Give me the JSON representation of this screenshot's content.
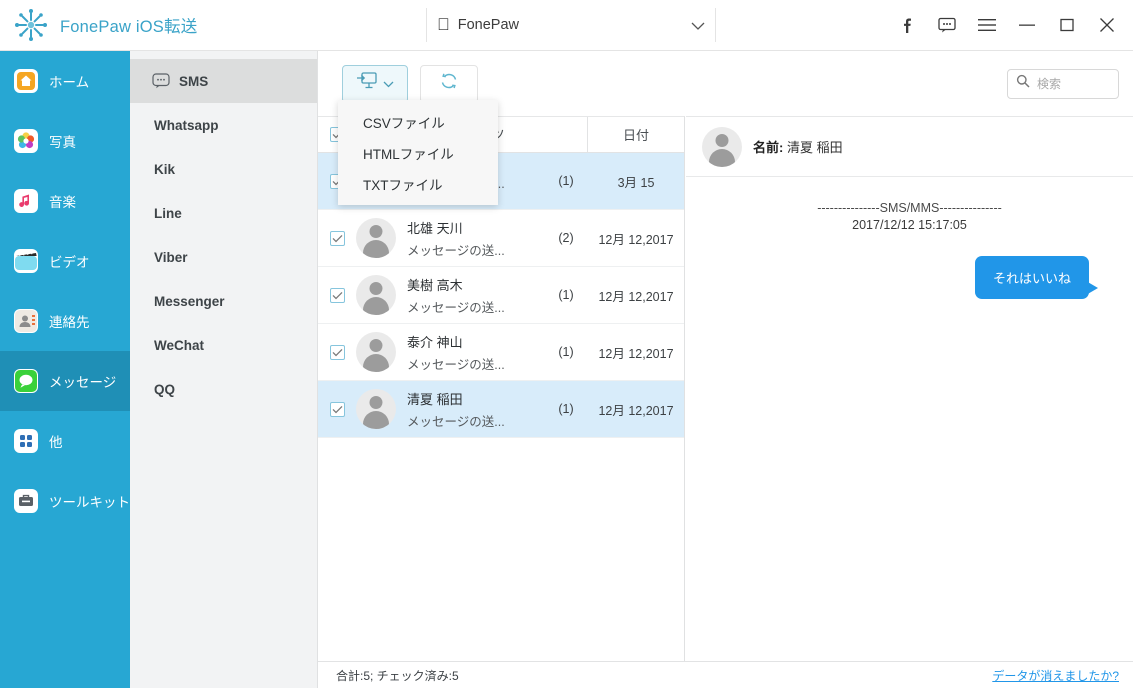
{
  "titlebar": {
    "logo_icon": "snowflake-logo",
    "app_title": "FonePaw iOS転送",
    "device": {
      "apple_icon": "apple-icon",
      "name": "FonePaw",
      "chevron_icon": "chevron-down-icon"
    },
    "controls": [
      {
        "name": "facebook-icon",
        "label": "f"
      },
      {
        "name": "feedback-icon",
        "label": ""
      },
      {
        "name": "menu-icon",
        "label": ""
      },
      {
        "name": "minimize-icon",
        "label": ""
      },
      {
        "name": "maximize-icon",
        "label": ""
      },
      {
        "name": "close-icon",
        "label": ""
      }
    ]
  },
  "sidebar": {
    "items": [
      {
        "label": "ホーム",
        "icon": "home-icon",
        "active": false
      },
      {
        "label": "写真",
        "icon": "photos-icon",
        "active": false
      },
      {
        "label": "音楽",
        "icon": "music-icon",
        "active": false
      },
      {
        "label": "ビデオ",
        "icon": "video-icon",
        "active": false
      },
      {
        "label": "連絡先",
        "icon": "contacts-icon",
        "active": false
      },
      {
        "label": "メッセージ",
        "icon": "messages-icon",
        "active": true
      },
      {
        "label": "他",
        "icon": "other-apps-icon",
        "active": false
      },
      {
        "label": "ツールキット",
        "icon": "toolkit-icon",
        "active": false
      }
    ]
  },
  "subnav": {
    "items": [
      {
        "label": "SMS",
        "icon": "sms-icon",
        "active": true
      },
      {
        "label": "Whatsapp",
        "active": false
      },
      {
        "label": "Kik",
        "active": false
      },
      {
        "label": "Line",
        "active": false
      },
      {
        "label": "Viber",
        "active": false
      },
      {
        "label": "Messenger",
        "active": false
      },
      {
        "label": "WeChat",
        "active": false
      },
      {
        "label": "QQ",
        "active": false
      }
    ]
  },
  "toolbar": {
    "export_icon": "export-to-pc-icon",
    "export_chevron_icon": "chevron-down-icon",
    "refresh_icon": "refresh-icon",
    "search": {
      "icon": "search-icon",
      "placeholder": "検索",
      "value": ""
    }
  },
  "export_menu": {
    "open": true,
    "items": [
      {
        "label": "CSVファイル"
      },
      {
        "label": "HTMLファイル"
      },
      {
        "label": "TXTファイル"
      }
    ]
  },
  "list": {
    "headers": {
      "check": "",
      "content": "コンテンツ",
      "date": "日付"
    },
    "header_check_icon": "checkbox-checked-icon",
    "rows": [
      {
        "checked": true,
        "selected": true,
        "name": "",
        "preview": "メッセージの送...",
        "count": "(1)",
        "date": "3月 15"
      },
      {
        "checked": true,
        "selected": false,
        "name": "北雄 天川",
        "preview": "メッセージの送...",
        "count": "(2)",
        "date": "12月 12,2017"
      },
      {
        "checked": true,
        "selected": false,
        "name": "美樹 高木",
        "preview": "メッセージの送...",
        "count": "(1)",
        "date": "12月 12,2017"
      },
      {
        "checked": true,
        "selected": false,
        "name": "泰介 神山",
        "preview": "メッセージの送...",
        "count": "(1)",
        "date": "12月 12,2017"
      },
      {
        "checked": true,
        "selected": true,
        "name": "清夏 稲田",
        "preview": "メッセージの送...",
        "count": "(1)",
        "date": "12月 12,2017"
      }
    ]
  },
  "detail": {
    "avatar_icon": "contact-avatar-icon",
    "name_label": "名前:",
    "name_value": "清夏 稲田",
    "separator": "---------------SMS/MMS---------------",
    "timestamp": "2017/12/12 15:17:05",
    "messages": [
      {
        "text": "それはいいね",
        "side": "outgoing"
      }
    ]
  },
  "statusbar": {
    "summary": "合計:5; チェック済み:5",
    "help_link": "データが消えましたか?"
  },
  "colors": {
    "sidebar": "#27a7d3",
    "sidebar_active": "#1f8fb6",
    "accent": "#2196e8",
    "brand_text": "#3aa3c8",
    "row_selected": "#d8ecfa"
  }
}
